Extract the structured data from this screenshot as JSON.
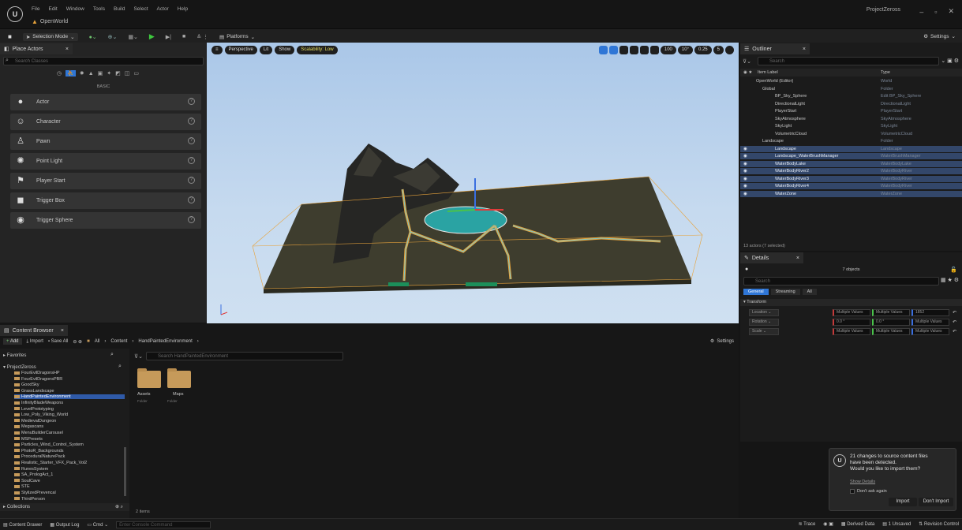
{
  "menu": [
    "File",
    "Edit",
    "Window",
    "Tools",
    "Build",
    "Select",
    "Actor",
    "Help"
  ],
  "project_tab": "OpenWorld",
  "window_title": "ProjectZeross",
  "toolbar": {
    "selection_mode": "Selection Mode",
    "platforms": "Platforms",
    "settings": "Settings"
  },
  "place_actors": {
    "tab": "Place Actors",
    "search_placeholder": "Search Classes",
    "category": "BASIC",
    "items": [
      {
        "label": "Actor",
        "icon": "actor-icon",
        "glyph": "●"
      },
      {
        "label": "Character",
        "icon": "character-icon",
        "glyph": "☺"
      },
      {
        "label": "Pawn",
        "icon": "pawn-icon",
        "glyph": "♙"
      },
      {
        "label": "Point Light",
        "icon": "light-bulb-icon",
        "glyph": "✺"
      },
      {
        "label": "Player Start",
        "icon": "player-start-icon",
        "glyph": "⚑"
      },
      {
        "label": "Trigger Box",
        "icon": "trigger-box-icon",
        "glyph": "◼"
      },
      {
        "label": "Trigger Sphere",
        "icon": "trigger-sphere-icon",
        "glyph": "◉"
      }
    ]
  },
  "viewport": {
    "perspective": "Perspective",
    "lit": "Lit",
    "show": "Show",
    "scalability": "Scalability: Low",
    "grid": "100",
    "angle": "10°",
    "scale": "0.25",
    "cam": "5"
  },
  "outliner": {
    "tab": "Outliner",
    "search_placeholder": "Search",
    "col_label": "Item Label",
    "col_type": "Type",
    "rows": [
      {
        "label": "OpenWorld (Editor)",
        "type": "World",
        "indent": 20,
        "sel": false
      },
      {
        "label": "Global",
        "type": "Folder",
        "indent": 28,
        "sel": false
      },
      {
        "label": "BP_Sky_Sphere",
        "type": "Edit BP_Sky_Sphere",
        "indent": 44,
        "sel": false
      },
      {
        "label": "DirectionalLight",
        "type": "DirectionalLight",
        "indent": 44,
        "sel": false
      },
      {
        "label": "PlayerStart",
        "type": "PlayerStart",
        "indent": 44,
        "sel": false
      },
      {
        "label": "SkyAtmosphere",
        "type": "SkyAtmosphere",
        "indent": 44,
        "sel": false
      },
      {
        "label": "SkyLight",
        "type": "SkyLight",
        "indent": 44,
        "sel": false
      },
      {
        "label": "VolumetricCloud",
        "type": "VolumetricCloud",
        "indent": 44,
        "sel": false
      },
      {
        "label": "Landscape",
        "type": "Folder",
        "indent": 28,
        "sel": false
      },
      {
        "label": "Landscape",
        "type": "Landscape",
        "indent": 44,
        "sel": true
      },
      {
        "label": "Landscape_WaterBrushManager",
        "type": "WaterBrushManager",
        "indent": 44,
        "sel": true
      },
      {
        "label": "WaterBodyLake",
        "type": "WaterBodyLake",
        "indent": 44,
        "sel": true
      },
      {
        "label": "WaterBodyRiver2",
        "type": "WaterBodyRiver",
        "indent": 44,
        "sel": true
      },
      {
        "label": "WaterBodyRiver3",
        "type": "WaterBodyRiver",
        "indent": 44,
        "sel": true
      },
      {
        "label": "WaterBodyRiver4",
        "type": "WaterBodyRiver",
        "indent": 44,
        "sel": true
      },
      {
        "label": "WaterZone",
        "type": "WaterZone",
        "indent": 44,
        "sel": true
      }
    ],
    "footer": "13 actors (7 selected)"
  },
  "details": {
    "tab": "Details",
    "objects": "7 objects",
    "search_placeholder": "Search",
    "filters": [
      "General",
      "Streaming",
      "All"
    ],
    "section": "Transform",
    "rows": [
      {
        "label": "Location",
        "v1": "Multiple Values",
        "v2": "Multiple Values",
        "v3": "1852"
      },
      {
        "label": "Rotation",
        "v1": "0.0 °",
        "v2": "0.0 °",
        "v3": "Multiple Values"
      },
      {
        "label": "Scale",
        "v1": "Multiple Values",
        "v2": "Multiple Values",
        "v3": "Multiple Values"
      }
    ]
  },
  "content_browser": {
    "tab": "Content Browser",
    "add": "Add",
    "import": "Import",
    "save_all": "Save All",
    "path": [
      "All",
      "Content",
      "HandPaintedEnvironment"
    ],
    "settings": "Settings",
    "search_placeholder": "Search HandPaintedEnvironment",
    "favorites": "Favorites",
    "root": "ProjectZeross",
    "tree": [
      "FourEvilDragonsHP",
      "FourEvilDragonsPBR",
      "GoodSky",
      "GrassLandscape",
      "HandPaintedEnvironment",
      "InfinityBladeWeapons",
      "LevelPrototyping",
      "Low_Poly_Viking_World",
      "MedievalDungeon",
      "Megascans",
      "MenuBuilderCarousel",
      "MSPresets",
      "Particles_Wind_Control_System",
      "PhotoR_Backgrounds",
      "ProceduralNaturePack",
      "Realistic_Starter_VFX_Pack_Vol2",
      "RunesSystem",
      "SA_PrologAct_1",
      "SoulCave",
      "STE",
      "StylizedPrevencal",
      "ThirdPerson"
    ],
    "selected_index": 4,
    "folders": [
      {
        "name": "Assets",
        "kind": "Folder"
      },
      {
        "name": "Maps",
        "kind": "Folder"
      }
    ],
    "collections": "Collections",
    "count": "2 items"
  },
  "notification": {
    "line1": "21 changes to source content files",
    "line2": "have been detected.",
    "line3": "Would you like to import them?",
    "link": "Show Details",
    "checkbox": "Don't ask again",
    "import": "Import",
    "dont_import": "Don't Import"
  },
  "status": {
    "content_drawer": "Content Drawer",
    "output_log": "Output Log",
    "cmd": "Cmd",
    "cmd_placeholder": "Enter Console Command",
    "trace": "Trace",
    "derived": "Derived Data",
    "unsaved": "1 Unsaved",
    "revision": "Revision Control"
  },
  "colors": {
    "accent": "#2f76d6",
    "play": "#3ec83e",
    "selection": "#33476a",
    "scalability": "#c9c14a",
    "water": "#2aa3a3",
    "spline": "#e8a33b"
  }
}
